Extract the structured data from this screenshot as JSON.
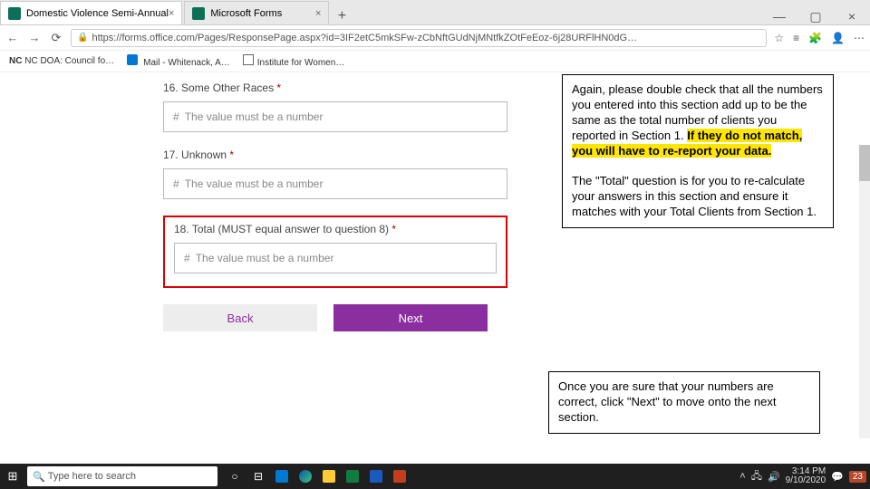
{
  "tabs": [
    {
      "title": "Domestic Violence Semi-Annual"
    },
    {
      "title": "Microsoft Forms"
    }
  ],
  "url": "https://forms.office.com/Pages/ResponsePage.aspx?id=3IF2etC5mkSFw-zCbNftGUdNjMNtfkZOtFeEoz-6j28URFlHN0dG…",
  "bookmarks": [
    {
      "label": "NC DOA: Council fo…",
      "prefix": "NC"
    },
    {
      "label": "Mail - Whitenack, A…"
    },
    {
      "label": "Institute for Women…"
    }
  ],
  "questions": [
    {
      "num": "16.",
      "label": "Some Other Races",
      "placeholder": "The value must be a number"
    },
    {
      "num": "17.",
      "label": "Unknown",
      "placeholder": "The value must be a number"
    },
    {
      "num": "18.",
      "label": "Total (MUST equal answer to question 8)",
      "placeholder": "The value must be a number",
      "boxed": true
    }
  ],
  "buttons": {
    "back": "Back",
    "next": "Next"
  },
  "callouts": {
    "top_pre": "Again, please double check that all the numbers you entered into this section add up to be the same as the total number of clients you reported in Section 1. ",
    "top_hl": "If they do not match, you will have to re-report your data.",
    "mid": "The \"Total\" question is for you to re-calculate your answers in this section and ensure it matches with your Total Clients from Section 1.",
    "bottom": "Once you are sure that your numbers are correct, click \"Next\" to move onto the next section."
  },
  "taskbar": {
    "search_placeholder": "Type here to search",
    "time": "3:14 PM",
    "date": "9/10/2020",
    "slide": "23"
  },
  "icons": {
    "hash": "#",
    "search": "🔍",
    "lock": "🔒",
    "star": "☆",
    "favlist": "≡",
    "ext": "🧩",
    "user": "👤",
    "more": "⋯",
    "close": "×",
    "plus": "+",
    "min": "—",
    "max": "▢"
  }
}
